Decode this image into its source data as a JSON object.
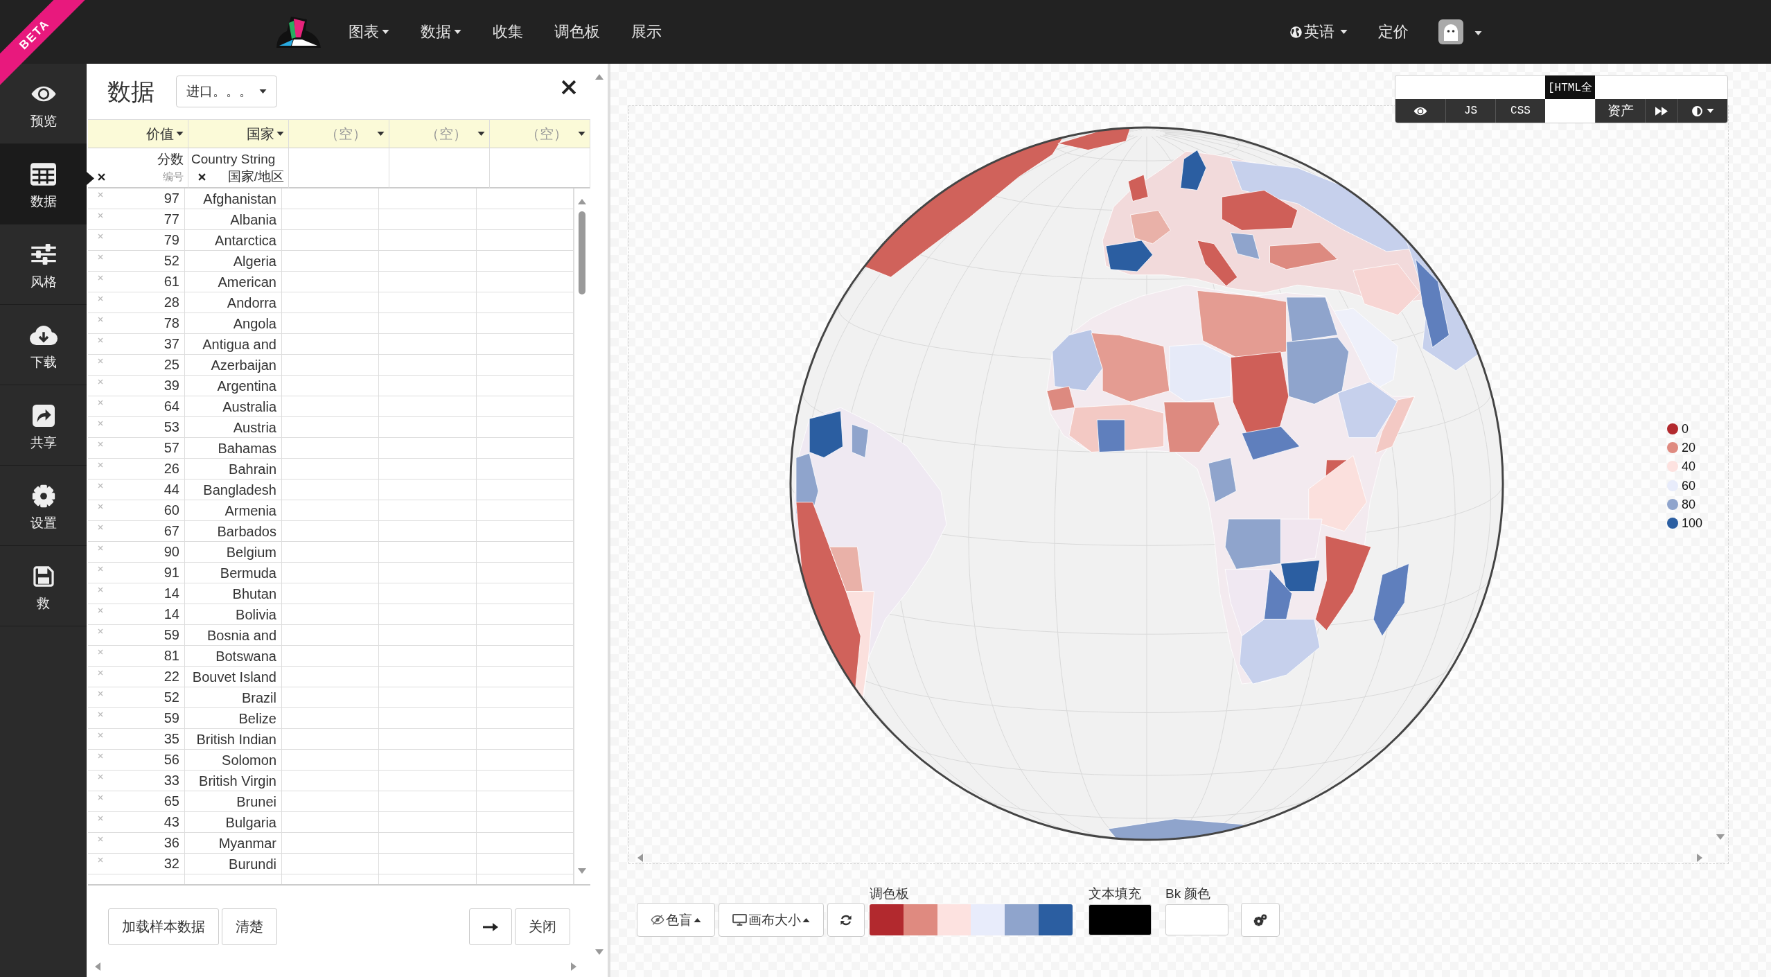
{
  "navbar": {
    "badge": "BETA",
    "menu": [
      {
        "label": "图表",
        "dropdown": true
      },
      {
        "label": "数据",
        "dropdown": true
      },
      {
        "label": "收集",
        "dropdown": false
      },
      {
        "label": "调色板",
        "dropdown": false
      },
      {
        "label": "展示",
        "dropdown": false
      }
    ],
    "language": "英语",
    "pricing": "定价"
  },
  "sidebar": {
    "items": [
      {
        "label": "预览",
        "selected": false
      },
      {
        "label": "数据",
        "selected": true
      },
      {
        "label": "风格",
        "selected": false
      },
      {
        "label": "下载",
        "selected": false
      },
      {
        "label": "共享",
        "selected": false
      },
      {
        "label": "设置",
        "selected": false
      },
      {
        "label": "救",
        "selected": false
      }
    ]
  },
  "data_panel": {
    "title": "数据",
    "import_menu": "进口。。。",
    "columns": [
      {
        "kind": "number",
        "label": "价值",
        "type": "分数",
        "format": "编号"
      },
      {
        "kind": "text",
        "label": "国家",
        "type": "Country String",
        "format": "国家/地区"
      },
      {
        "kind": "empty",
        "label": "（空）"
      },
      {
        "kind": "empty",
        "label": "（空）"
      },
      {
        "kind": "empty",
        "label": "（空）"
      }
    ],
    "rows": [
      {
        "value": "97",
        "country": "Afghanistan"
      },
      {
        "value": "77",
        "country": "Albania"
      },
      {
        "value": "79",
        "country": "Antarctica"
      },
      {
        "value": "52",
        "country": "Algeria"
      },
      {
        "value": "61",
        "country": "American"
      },
      {
        "value": "28",
        "country": "Andorra"
      },
      {
        "value": "78",
        "country": "Angola"
      },
      {
        "value": "37",
        "country": "Antigua and"
      },
      {
        "value": "25",
        "country": "Azerbaijan"
      },
      {
        "value": "39",
        "country": "Argentina"
      },
      {
        "value": "64",
        "country": "Australia"
      },
      {
        "value": "53",
        "country": "Austria"
      },
      {
        "value": "57",
        "country": "Bahamas"
      },
      {
        "value": "26",
        "country": "Bahrain"
      },
      {
        "value": "44",
        "country": "Bangladesh"
      },
      {
        "value": "60",
        "country": "Armenia"
      },
      {
        "value": "67",
        "country": "Barbados"
      },
      {
        "value": "90",
        "country": "Belgium"
      },
      {
        "value": "91",
        "country": "Bermuda"
      },
      {
        "value": "14",
        "country": "Bhutan"
      },
      {
        "value": "14",
        "country": "Bolivia"
      },
      {
        "value": "59",
        "country": "Bosnia and"
      },
      {
        "value": "81",
        "country": "Botswana"
      },
      {
        "value": "22",
        "country": "Bouvet Island"
      },
      {
        "value": "52",
        "country": "Brazil"
      },
      {
        "value": "59",
        "country": "Belize"
      },
      {
        "value": "35",
        "country": "British Indian"
      },
      {
        "value": "56",
        "country": "Solomon"
      },
      {
        "value": "33",
        "country": "British Virgin"
      },
      {
        "value": "65",
        "country": "Brunei"
      },
      {
        "value": "43",
        "country": "Bulgaria"
      },
      {
        "value": "36",
        "country": "Myanmar"
      },
      {
        "value": "32",
        "country": "Burundi"
      }
    ],
    "left_buttons": [
      "加载样本数据",
      "清楚"
    ],
    "right_buttons": [
      {
        "kind": "arrow"
      },
      {
        "kind": "text",
        "label": "关闭"
      }
    ]
  },
  "chart": {
    "export_toolbar": [
      {
        "kind": "icon"
      },
      {
        "kind": "text",
        "label": "JS"
      },
      {
        "kind": "text",
        "label": "CSS"
      },
      {
        "kind": "overflow",
        "label": "[HTML全"
      },
      {
        "kind": "text",
        "label": "资产"
      },
      {
        "kind": "icon"
      },
      {
        "kind": "menu"
      }
    ],
    "legend": [
      {
        "label": "0",
        "color": "#b2292e"
      },
      {
        "label": "20",
        "color": "#df8a80"
      },
      {
        "label": "40",
        "color": "#fde2e0"
      },
      {
        "label": "60",
        "color": "#e8ecfb"
      },
      {
        "label": "80",
        "color": "#8fa4cc"
      },
      {
        "label": "100",
        "color": "#2b5ea1"
      }
    ]
  },
  "canvas_toolbar": {
    "colorblind": "色盲",
    "canvas_size": "画布大小",
    "palette": {
      "label": "调色板",
      "colors": [
        {
          "color": "#b2292e"
        },
        {
          "color": "#df8a80"
        },
        {
          "color": "#fde2e0"
        },
        {
          "color": "#e8ecfb"
        },
        {
          "color": "#8fa4cc"
        },
        {
          "color": "#2b5ea1"
        }
      ]
    },
    "text_fill": {
      "label": "文本填充",
      "color": "#000000"
    },
    "background": {
      "label": "Bk 颜色",
      "color": "#ffffff"
    }
  }
}
